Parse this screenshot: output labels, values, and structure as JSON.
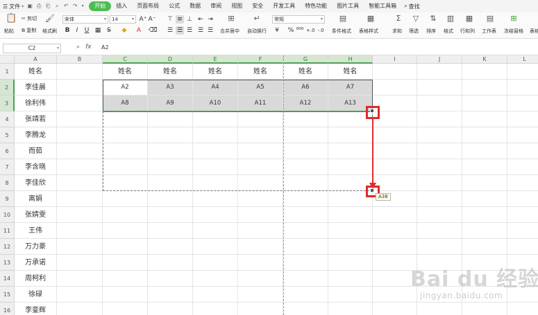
{
  "menubar": {
    "file_label": "文件",
    "tabs": [
      "开始",
      "插入",
      "页面布局",
      "公式",
      "数据",
      "审阅",
      "视图",
      "安全",
      "开发工具",
      "特色功能",
      "图片工具",
      "智能工具箱"
    ],
    "active_tab": "开始",
    "search_label": "查找"
  },
  "ribbon": {
    "paste_label": "粘贴",
    "cut_label": "剪切",
    "copy_label": "复制",
    "format_painter_label": "格式刷",
    "font_name": "宋体",
    "font_size": "14",
    "merge_center_label": "合并居中",
    "wrap_text_label": "自动换行",
    "number_format": "常规",
    "conditional_format_label": "条件格式",
    "table_style_label": "表格样式",
    "sum_label": "求和",
    "filter_label": "筛选",
    "sort_label": "排序",
    "format_label": "格式",
    "row_col_label": "行和列",
    "worksheet_label": "工作表",
    "freeze_label": "冻结窗格",
    "table_tools_label": "表格"
  },
  "formula_bar": {
    "name_box": "C2",
    "fx_label": "fx",
    "value": "A2"
  },
  "sheet": {
    "columns": [
      "A",
      "B",
      "C",
      "D",
      "E",
      "F",
      "G",
      "H",
      "I",
      "J",
      "K",
      "L"
    ],
    "selected_columns": [
      "C",
      "D",
      "E",
      "F",
      "G",
      "H"
    ],
    "rows": [
      "1",
      "2",
      "3",
      "4",
      "5",
      "6",
      "7",
      "8",
      "9",
      "10",
      "11",
      "12",
      "13",
      "14",
      "15",
      "16"
    ],
    "selected_rows": [
      "2",
      "3"
    ],
    "col_a_values": [
      "姓名",
      "李佳晨",
      "徐利伟",
      "张靖若",
      "李腾龙",
      "而茹",
      "李含晓",
      "李佳欣",
      "离娟",
      "张婧雯",
      "王伟",
      "万力豪",
      "万承诺",
      "周柯利",
      "徐碌",
      "李銮辉"
    ],
    "header_row": [
      "姓名",
      "姓名",
      "姓名",
      "姓名",
      "姓名",
      "姓名"
    ],
    "row2": [
      "A2",
      "A3",
      "A4",
      "A5",
      "A6",
      "A7"
    ],
    "row3": [
      "A8",
      "A9",
      "A10",
      "A11",
      "A12",
      "A13"
    ],
    "fill_tooltip": "A38"
  },
  "colors": {
    "accent_green": "#4ebc53",
    "annotation_red": "#e02a2a",
    "selection_grey": "#d9d9d9"
  },
  "watermark": {
    "main": "Bai du 经验",
    "sub": "jingyan.baidu.com"
  }
}
